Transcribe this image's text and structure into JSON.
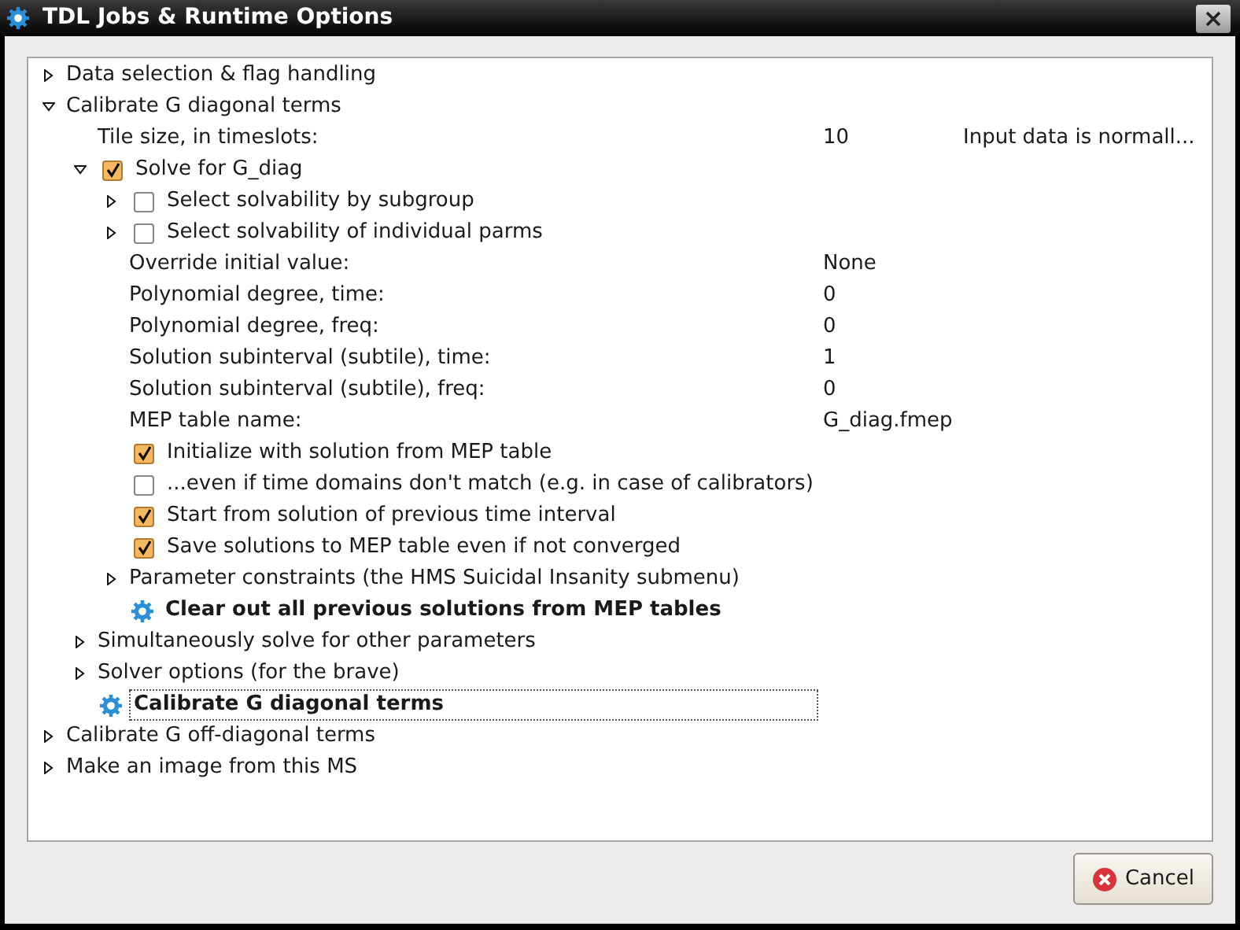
{
  "window": {
    "title": "TDL Jobs & Runtime Options"
  },
  "tree": [
    {
      "kind": "branch",
      "label": "Data selection & flag handling",
      "expanded": false
    },
    {
      "kind": "branch",
      "label": "Calibrate G diagonal terms",
      "expanded": true,
      "children": [
        {
          "kind": "field",
          "label": "Tile size, in timeslots:",
          "value": "10",
          "note": "Input data is normall..."
        },
        {
          "kind": "branch",
          "label": "Solve for G_diag",
          "expanded": true,
          "checked": true,
          "children": [
            {
              "kind": "branch",
              "label": "Select solvability by subgroup",
              "expanded": false,
              "checked": false
            },
            {
              "kind": "branch",
              "label": "Select solvability of individual parms",
              "expanded": false,
              "checked": false
            },
            {
              "kind": "field",
              "label": "Override initial value:",
              "value": "None"
            },
            {
              "kind": "field",
              "label": "Polynomial degree, time:",
              "value": "0"
            },
            {
              "kind": "field",
              "label": "Polynomial degree, freq:",
              "value": "0"
            },
            {
              "kind": "field",
              "label": "Solution subinterval (subtile), time:",
              "value": "1"
            },
            {
              "kind": "field",
              "label": "Solution subinterval (subtile), freq:",
              "value": "0"
            },
            {
              "kind": "field",
              "label": "MEP table name:",
              "value": "G_diag.fmep"
            },
            {
              "kind": "check",
              "label": "Initialize with solution from MEP table",
              "checked": true
            },
            {
              "kind": "check",
              "label": "...even if time domains don't match (e.g. in case of calibrators)",
              "checked": false
            },
            {
              "kind": "check",
              "label": "Start from solution of previous time interval",
              "checked": true
            },
            {
              "kind": "check",
              "label": "Save solutions to MEP table even if not converged",
              "checked": true
            },
            {
              "kind": "branch",
              "label": "Parameter constraints (the HMS Suicidal Insanity submenu)",
              "expanded": false
            },
            {
              "kind": "action",
              "label": "Clear out all previous solutions from MEP tables",
              "focused": false
            }
          ]
        },
        {
          "kind": "branch",
          "label": "Simultaneously solve for other parameters",
          "expanded": false
        },
        {
          "kind": "branch",
          "label": "Solver options (for the brave)",
          "expanded": false
        },
        {
          "kind": "action",
          "label": "Calibrate G diagonal terms",
          "focused": true
        }
      ]
    },
    {
      "kind": "branch",
      "label": "Calibrate G off-diagonal terms",
      "expanded": false
    },
    {
      "kind": "branch",
      "label": "Make an image from this MS",
      "expanded": false
    }
  ],
  "buttons": [
    {
      "label": "Cancel"
    }
  ]
}
